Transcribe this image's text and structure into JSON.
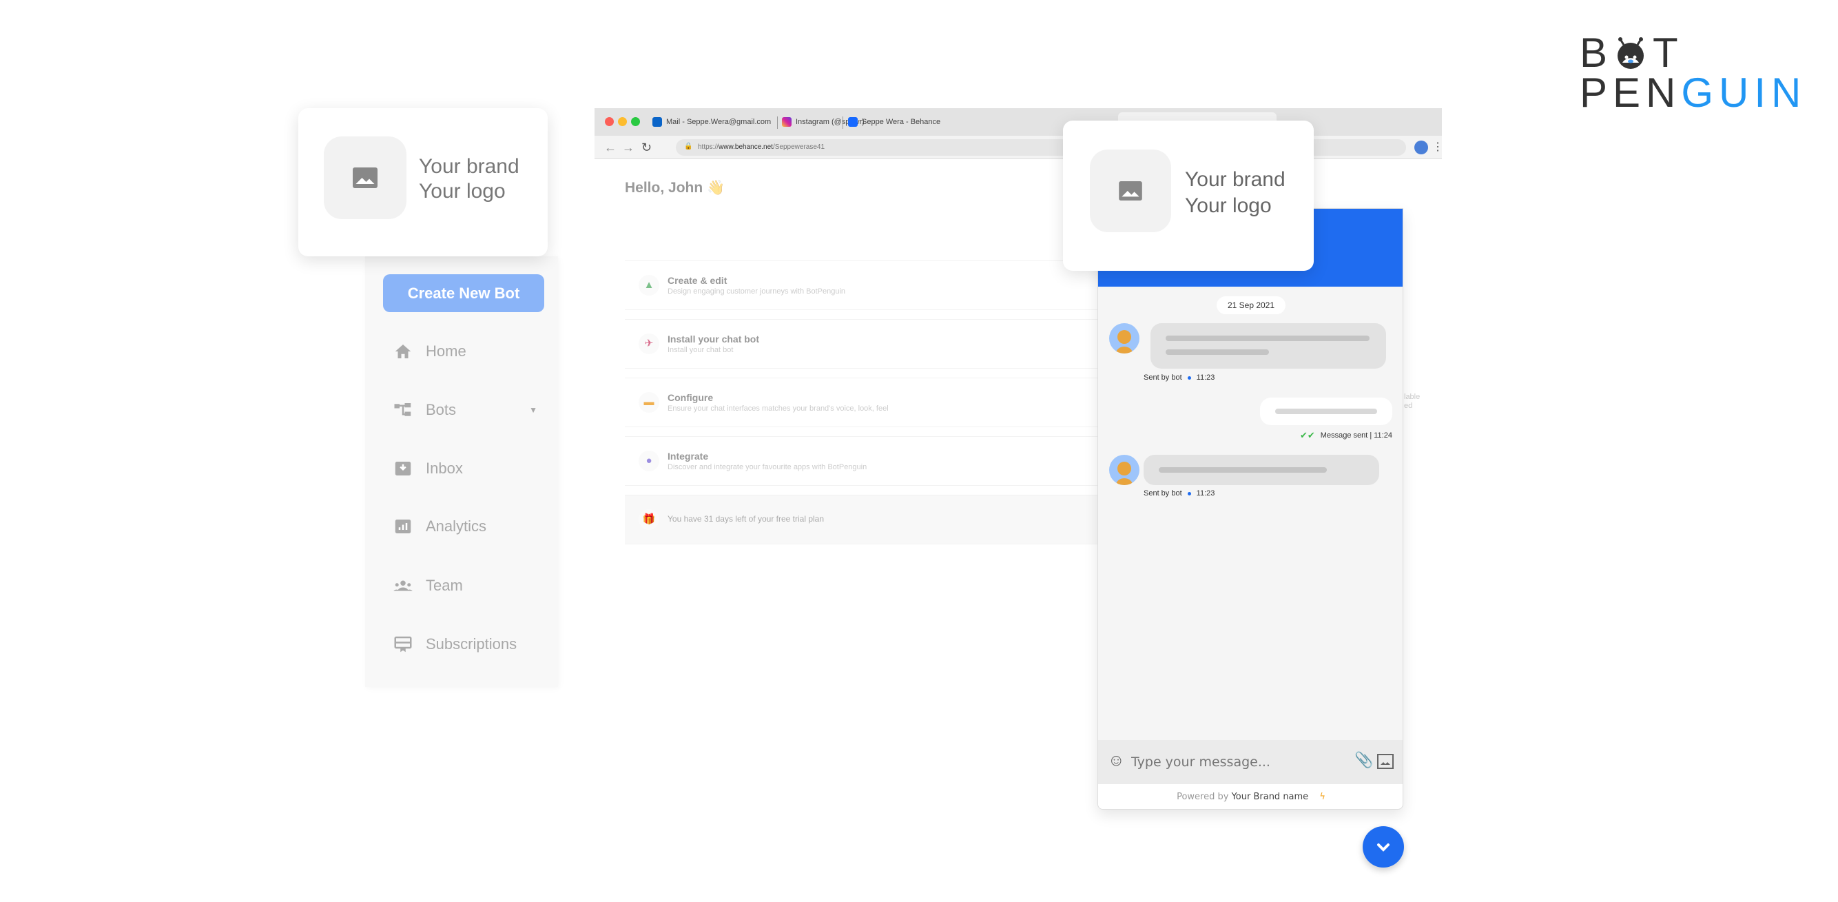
{
  "browser": {
    "tabs": [
      {
        "label": "Mail - Seppe.Wera@gmail.com",
        "icon": "outlook-icon",
        "color": "#0a64c8"
      },
      {
        "label": "Instagram (@sppwr)",
        "icon": "instagram-icon",
        "color": "#d6249f"
      },
      {
        "label": "Seppe Wera - Behance",
        "icon": "behance-icon",
        "color": "#1769ff"
      }
    ],
    "url_prefix": "https://",
    "url_domain": "www.behance.net",
    "url_path": "/Seppewerase41"
  },
  "dashboard": {
    "greeting": "Hello, John",
    "greeting_emoji": "👋",
    "cards": [
      {
        "title": "Create & edit",
        "desc": "Design engaging customer journeys with BotPenguin",
        "icon": "shapes-icon"
      },
      {
        "title": "Install your chat bot",
        "desc": "Install your chat bot",
        "icon": "rocket-icon"
      },
      {
        "title": "Configure",
        "desc": "Ensure your chat interfaces matches your brand's voice, look, feel",
        "icon": "cake-icon"
      },
      {
        "title": "Integrate",
        "desc": "Discover and integrate your favourite apps with BotPenguin",
        "icon": "compass-icon"
      }
    ],
    "trial": "You have 31 days left of your free trial plan",
    "side_fragment": [
      "lable",
      "ed"
    ]
  },
  "brand_card": {
    "line1": "Your brand",
    "line2": "Your logo"
  },
  "sidebar": {
    "create_button": "Create New Bot",
    "items": [
      {
        "label": "Home",
        "icon": "home-icon"
      },
      {
        "label": "Bots",
        "icon": "bots-icon"
      },
      {
        "label": "Inbox",
        "icon": "inbox-icon"
      },
      {
        "label": "Analytics",
        "icon": "analytics-icon"
      },
      {
        "label": "Team",
        "icon": "team-icon"
      },
      {
        "label": "Subscriptions",
        "icon": "subscriptions-icon"
      }
    ]
  },
  "chat": {
    "date": "21 Sep 2021",
    "bot_meta_label": "Sent by bot",
    "bot_time_1": "11:23",
    "bot_time_2": "11:23",
    "user_status": "Message sent | 11:24",
    "input_placeholder": "Type your message...",
    "powered_by": "Powered by",
    "brand_name": "Your Brand name",
    "accent": "#1f6cf0"
  },
  "logo": {
    "line1_a": "B",
    "line1_b": "T",
    "line2_dark": "PEN",
    "line2_blue": "GUIN",
    "blue": "#2196f3"
  }
}
